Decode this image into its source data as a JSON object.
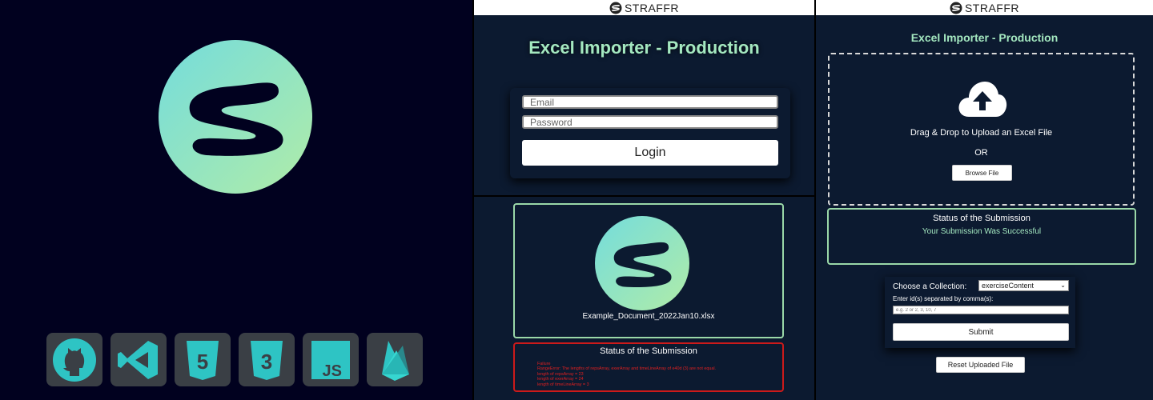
{
  "colors": {
    "left_bg": "#01011f",
    "panel_bg": "#0c1a30",
    "accent_green": "#a4e8c0",
    "logo_gradient_start": "#7be0dc",
    "logo_gradient_end": "#a9eab0",
    "error_red": "#e02020"
  },
  "tech_stack": [
    {
      "icon": "github-icon"
    },
    {
      "icon": "vscode-icon"
    },
    {
      "icon": "html5-icon",
      "text": "5"
    },
    {
      "icon": "css3-icon",
      "text": "3"
    },
    {
      "icon": "javascript-icon",
      "text": "JS"
    },
    {
      "icon": "firebase-icon"
    }
  ],
  "topbar": {
    "brand": "STRAFFR"
  },
  "login": {
    "title": "Excel Importer - Production",
    "email_placeholder": "Email",
    "password_placeholder": "Password",
    "login_label": "Login"
  },
  "failure_view": {
    "file_name": "Example_Document_2022Jan10.xlsx",
    "status_title": "Status of the Submission",
    "error_lines": [
      "Failure",
      "RangeError: The lengths of repsArray, exerArray and timeLineArray of e40d (3) are not equal.",
      "length of repsArray = 23",
      "length of exerArray = 24",
      "length of timeLineArray = 3"
    ]
  },
  "upload_view": {
    "title": "Excel Importer - Production",
    "drop_text": "Drag & Drop to Upload an Excel File",
    "or_text": "OR",
    "browse_label": "Browse File",
    "status_title": "Status of the Submission",
    "status_message": "Your Submission Was Successful",
    "collection_label": "Choose a Collection:",
    "collection_value": "exerciseContent",
    "ids_label": "Enter id(s) separated by comma(s):",
    "ids_placeholder": "e.g. 2 or 2, 3, 10, 7",
    "submit_label": "Submit",
    "reset_label": "Reset Uploaded File"
  }
}
